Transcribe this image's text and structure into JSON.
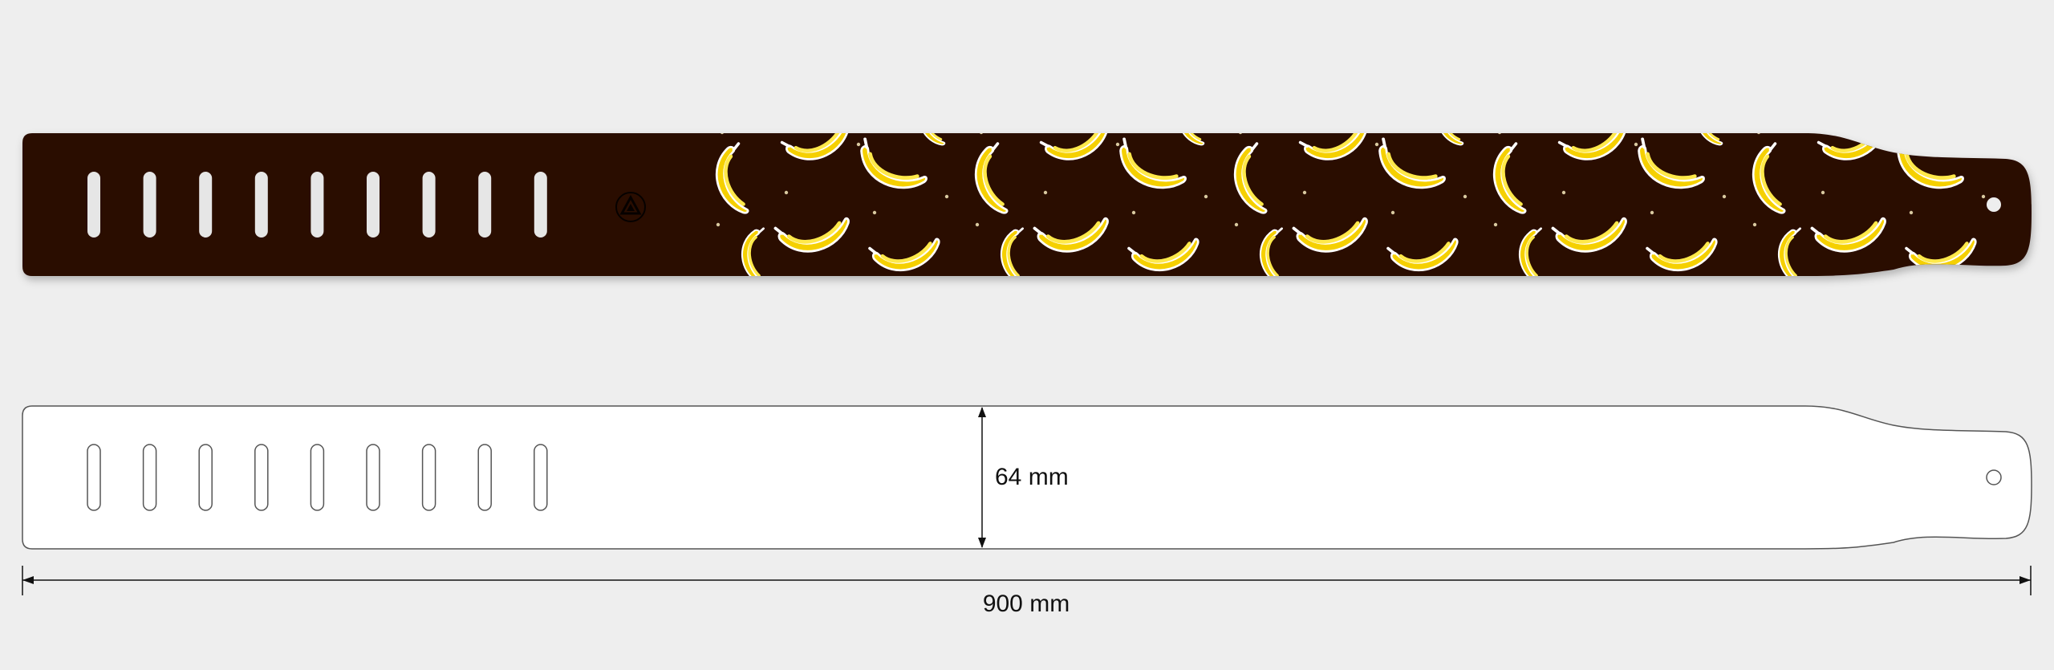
{
  "strap": {
    "color": "#2a0e05",
    "pattern_name": "banana-pattern",
    "slot_count": 9
  },
  "outline": {
    "fill": "#ffffff",
    "stroke": "#555555",
    "slot_count": 9
  },
  "dimensions": {
    "width_label": "64 mm",
    "length_label": "900 mm"
  },
  "colors": {
    "banana_yellow": "#f5d000",
    "banana_light": "#ffe94a",
    "banana_outline": "#ffffff",
    "background": "#eeeeee"
  }
}
